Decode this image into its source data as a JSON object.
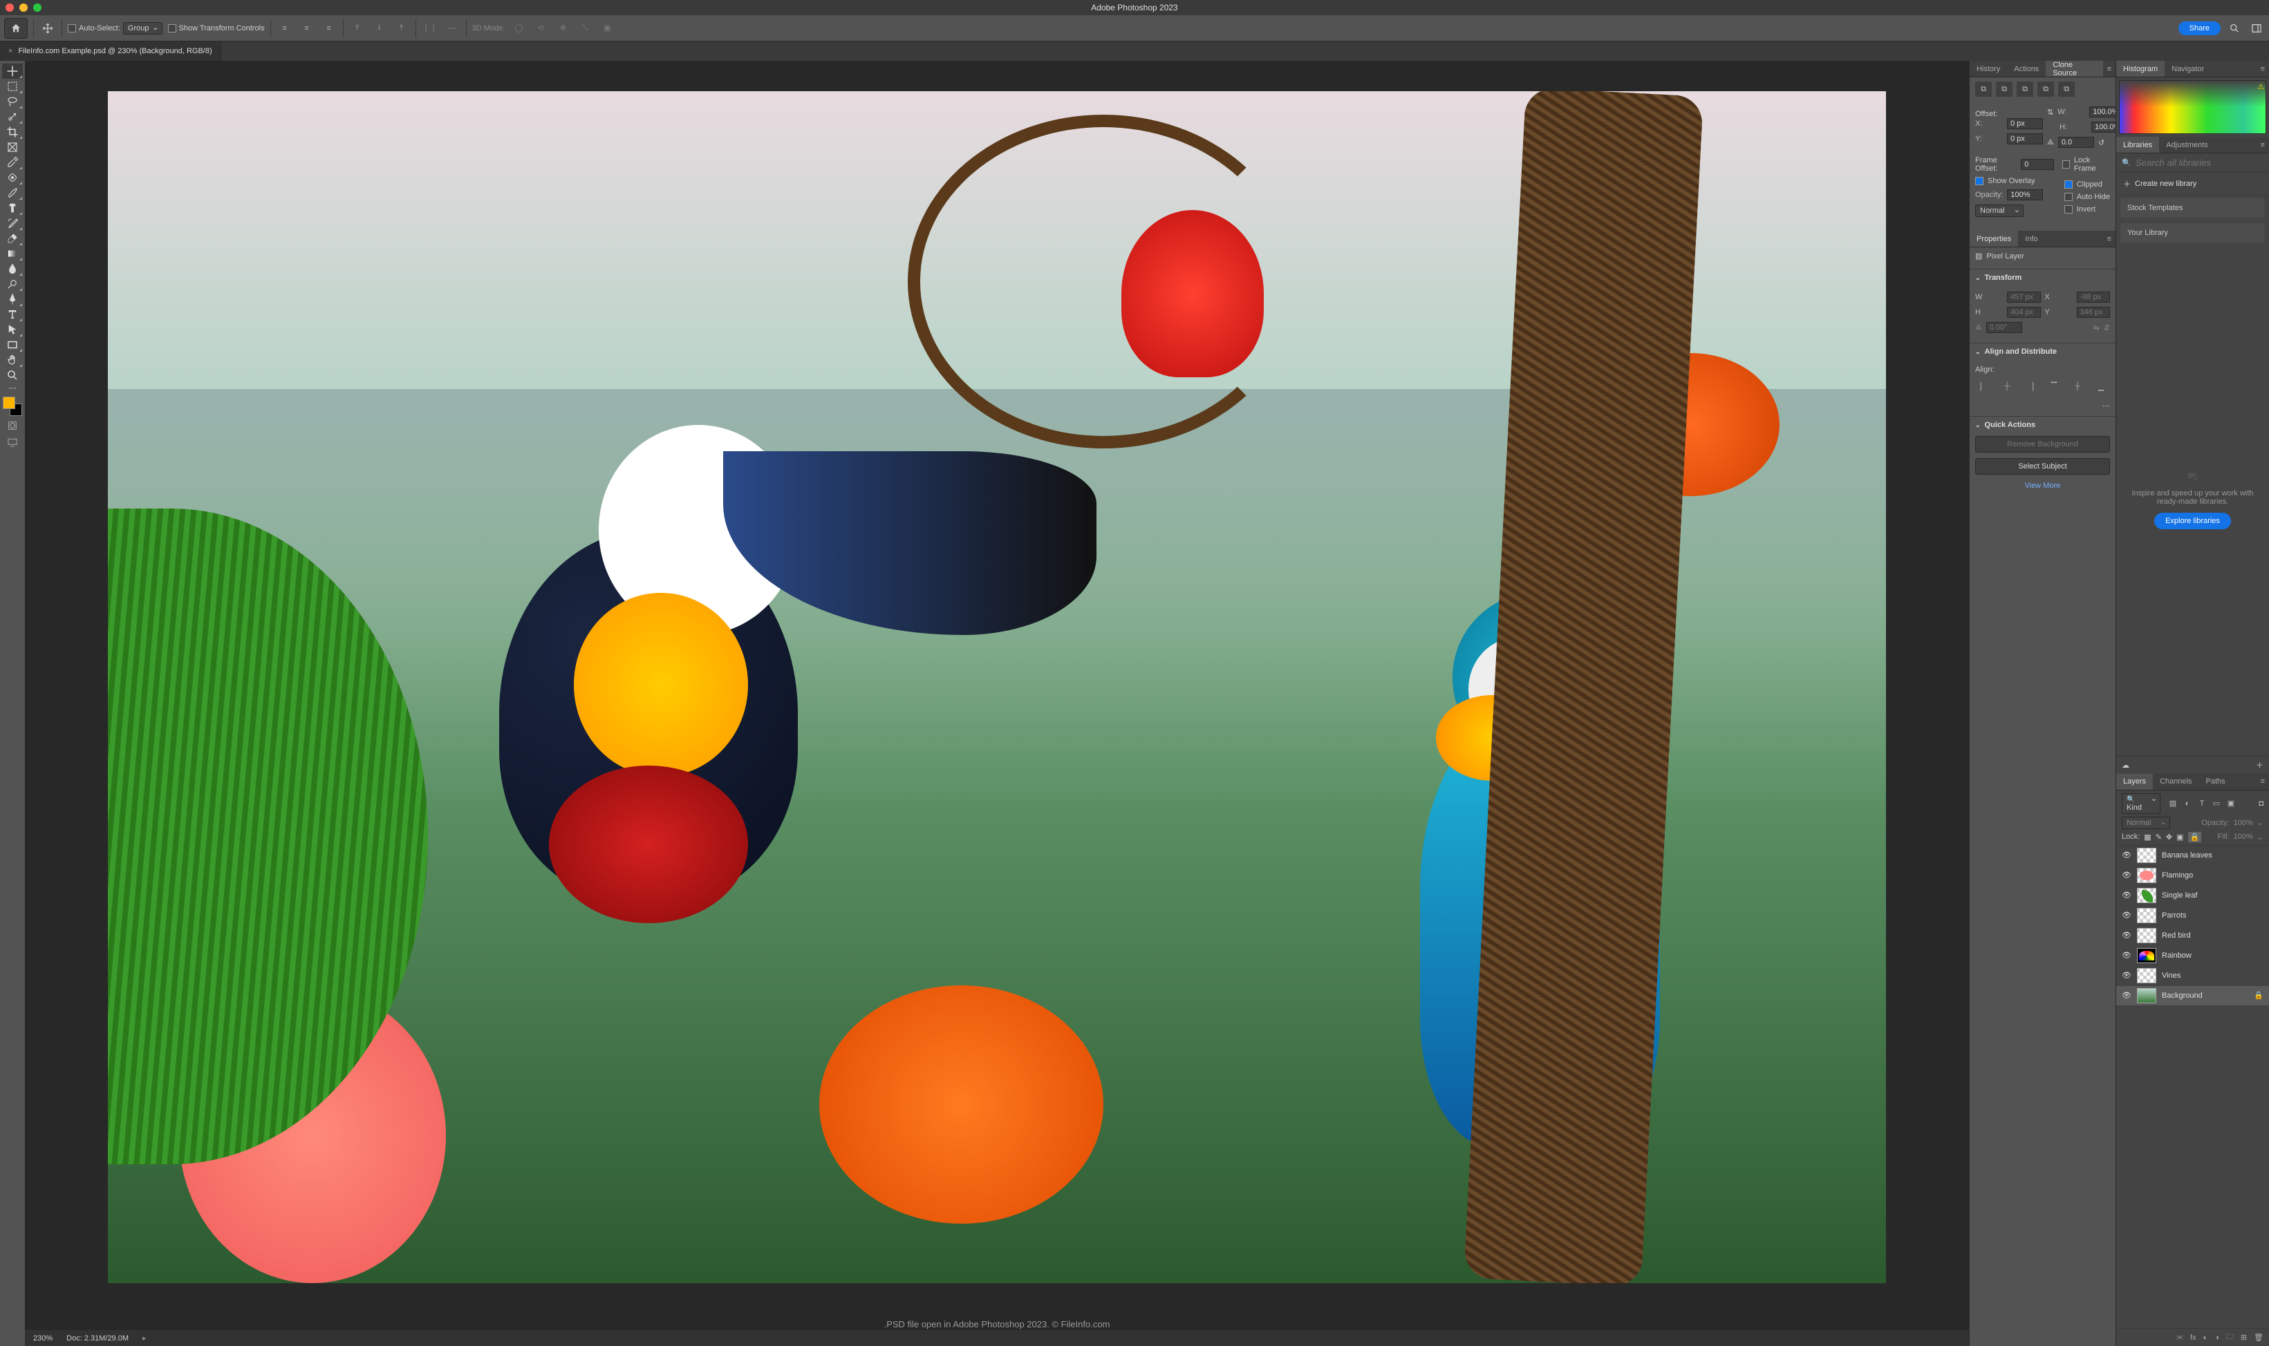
{
  "window": {
    "title": "Adobe Photoshop 2023"
  },
  "optionsbar": {
    "auto_select_label": "Auto-Select:",
    "auto_select_value": "Group",
    "show_transform_label": "Show Transform Controls",
    "mode3d_label": "3D Mode:"
  },
  "share": {
    "label": "Share"
  },
  "document": {
    "tab_title": "FileInfo.com Example.psd @ 230% (Background, RGB/8)",
    "caption": ".PSD file open in Adobe Photoshop 2023. © FileInfo.com"
  },
  "statusbar": {
    "zoom": "230%",
    "doc_info": "Doc: 2.31M/29.0M"
  },
  "panels_left": {
    "tabs": {
      "history": "History",
      "actions": "Actions",
      "clone_source": "Clone Source"
    },
    "clone_source": {
      "offset_label": "Offset:",
      "x_label": "X:",
      "x_value": "0 px",
      "y_label": "Y:",
      "y_value": "0 px",
      "w_label": "W:",
      "w_value": "100.0%",
      "h_label": "H:",
      "h_value": "100.0%",
      "angle_value": "0.0",
      "frame_offset_label": "Frame Offset:",
      "frame_offset_value": "0",
      "lock_frame_label": "Lock Frame",
      "show_overlay_label": "Show Overlay",
      "clipped_label": "Clipped",
      "opacity_label": "Opacity:",
      "opacity_value": "100%",
      "auto_hide_label": "Auto Hide",
      "invert_label": "Invert",
      "blend_mode": "Normal"
    },
    "properties_tabs": {
      "properties": "Properties",
      "info": "Info"
    },
    "properties": {
      "type_label": "Pixel Layer",
      "transform_header": "Transform",
      "w_label": "W",
      "w_value": "457 px",
      "h_label": "H",
      "h_value": "404 px",
      "x_label": "X",
      "x_value": "-98 px",
      "y_label": "Y",
      "y_value": "346 px",
      "angle_value": "0.00°",
      "align_header": "Align and Distribute",
      "align_label": "Align:",
      "quick_header": "Quick Actions",
      "remove_bg_label": "Remove Background",
      "select_subject_label": "Select Subject",
      "view_more_label": "View More"
    }
  },
  "panels_right": {
    "hist_tabs": {
      "histogram": "Histogram",
      "navigator": "Navigator"
    },
    "lib_tabs": {
      "libraries": "Libraries",
      "adjustments": "Adjustments"
    },
    "libraries": {
      "search_placeholder": "Search all libraries",
      "create_label": "Create new library",
      "stock_label": "Stock Templates",
      "your_label": "Your Library",
      "empty_text": "Inspire and speed up your work with ready-made libraries.",
      "explore_label": "Explore libraries"
    },
    "layers_tabs": {
      "layers": "Layers",
      "channels": "Channels",
      "paths": "Paths"
    },
    "layers": {
      "kind_label": "Kind",
      "blend_mode": "Normal",
      "opacity_label": "Opacity:",
      "opacity_value": "100%",
      "lock_label": "Lock:",
      "fill_label": "Fill:",
      "fill_value": "100%",
      "items": [
        {
          "name": "Banana leaves"
        },
        {
          "name": "Flamingo"
        },
        {
          "name": "Single leaf"
        },
        {
          "name": "Parrots"
        },
        {
          "name": "Red bird"
        },
        {
          "name": "Rainbow"
        },
        {
          "name": "Vines"
        },
        {
          "name": "Background"
        }
      ]
    }
  }
}
